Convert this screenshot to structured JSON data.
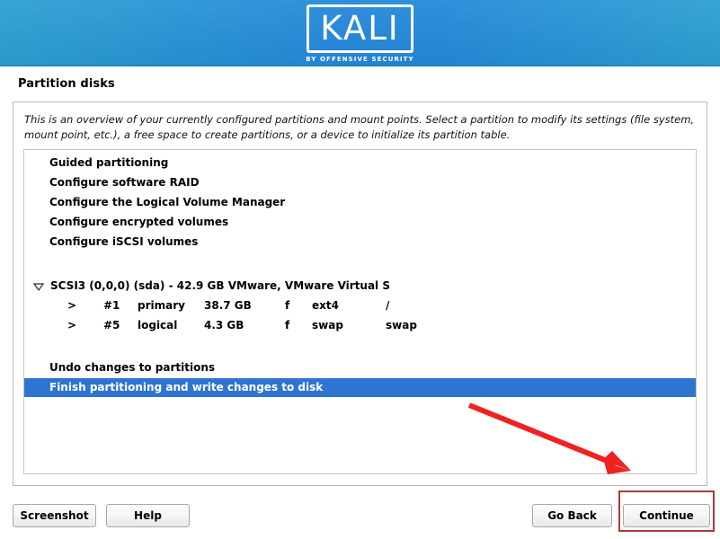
{
  "header": {
    "logo_text": "KALI",
    "logo_subtitle": "BY OFFENSIVE SECURITY",
    "gradient_left": "#2ba0d1",
    "gradient_center": "#2487da"
  },
  "page_title": "Partition disks",
  "description": "This is an overview of your currently configured partitions and mount points. Select a partition to modify its settings (file system, mount point, etc.), a free space to create partitions, or a device to initialize its partition table.",
  "list": {
    "menu_items": [
      {
        "label": "Guided partitioning",
        "selected": false
      },
      {
        "label": "Configure software RAID",
        "selected": false
      },
      {
        "label": "Configure the Logical Volume Manager",
        "selected": false
      },
      {
        "label": "Configure encrypted volumes",
        "selected": false
      },
      {
        "label": "Configure iSCSI volumes",
        "selected": false
      }
    ],
    "disk": {
      "label": "SCSI3 (0,0,0) (sda) - 42.9 GB VMware, VMware Virtual S",
      "expanded": true,
      "partitions": [
        {
          "arrow": ">",
          "number": "#1",
          "type": "primary",
          "size": "38.7 GB",
          "flag": "f",
          "filesystem": "ext4",
          "mountpoint": "/"
        },
        {
          "arrow": ">",
          "number": "#5",
          "type": "logical",
          "size": "4.3 GB",
          "flag": "f",
          "filesystem": "swap",
          "mountpoint": "swap"
        }
      ]
    },
    "action_items": [
      {
        "label": "Undo changes to partitions",
        "selected": false
      },
      {
        "label": "Finish partitioning and write changes to disk",
        "selected": true
      }
    ],
    "selection_color": "#2f74d0"
  },
  "annotations": {
    "arrow_color": "#ee2222",
    "highlight_box_color": "#b03838"
  },
  "footer": {
    "screenshot_label": "Screenshot",
    "help_label": "Help",
    "go_back_label": "Go Back",
    "continue_label": "Continue"
  }
}
